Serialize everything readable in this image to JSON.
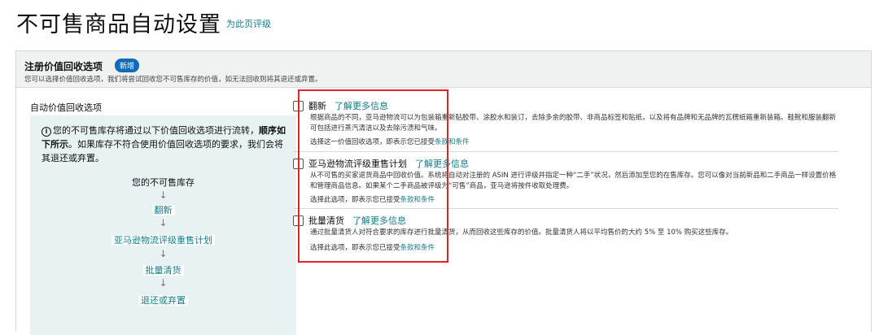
{
  "header": {
    "title": "不可售商品自动设置",
    "rate_link": "为此页评级"
  },
  "panel": {
    "title": "注册价值回收选项",
    "badge": "新增",
    "description": "您可以选择价值回收选项，我们将尝试回收您不可售库存的价值，如无法回收则将其退还或弃置。"
  },
  "left": {
    "label": "自动价值回收选项",
    "intro_prefix": "您的不可售库存将通过以下价值回收选项进行流转，",
    "intro_bold": "顺序如下所示",
    "intro_suffix": "。如果库存不符合使用价值回收选项的要求，我们会将其退还或弃置。",
    "steps": [
      "您的不可售库存",
      "翻新",
      "亚马逊物流评级重售计划",
      "批量清货",
      "退还或弃置"
    ],
    "arrow": "↓"
  },
  "options": [
    {
      "title": "翻新",
      "learn_more": "了解更多信息",
      "description": "根据商品的不同，亚马逊物流可以为包装箱重新贴胶带、涂胶水和装订，去除多余的胶带、非商品标签和贴纸，以及将有品牌和无品牌的瓦楞纸箱重新装箱。鞋靴和服装翻新可包括进行蒸汽清洁以及去除污渍和气味。",
      "accept_prefix": "选择这一价值回收选项，即表示您已接受",
      "accept_link": "条款和条件",
      "checked": false
    },
    {
      "title": "亚马逊物流评级重售计划",
      "learn_more": "了解更多信息",
      "description": "从不可售的买家退货商品中回收价值。系统将自动对注册的 ASIN 进行评级并指定一种“二手”状况，然后添加至您的在售库存。您可以像对当前新品和二手商品一样设置价格和管理商品信息。如果某个二手商品被评级为“可售”商品，亚马逊将按件收取处理费。",
      "accept_prefix": "选择此选项，即表示您已接受",
      "accept_link": "条款和条件",
      "checked": false
    },
    {
      "title": "批量清货",
      "learn_more": "了解更多信息",
      "description": "通过批量清货人对符合要求的库存进行批量清货，从而回收这些库存的价值。批量清货人将以平均售价的大约 5% 至 10% 购买这些库存。",
      "accept_prefix": "选择此选项，即表示您已接受",
      "accept_link": "条款和条件",
      "checked": false
    }
  ],
  "colors": {
    "link": "#0f7d8a",
    "badge": "#0f6cbd",
    "highlight_border": "#e02424",
    "flow_background": "#e9f2f3"
  }
}
